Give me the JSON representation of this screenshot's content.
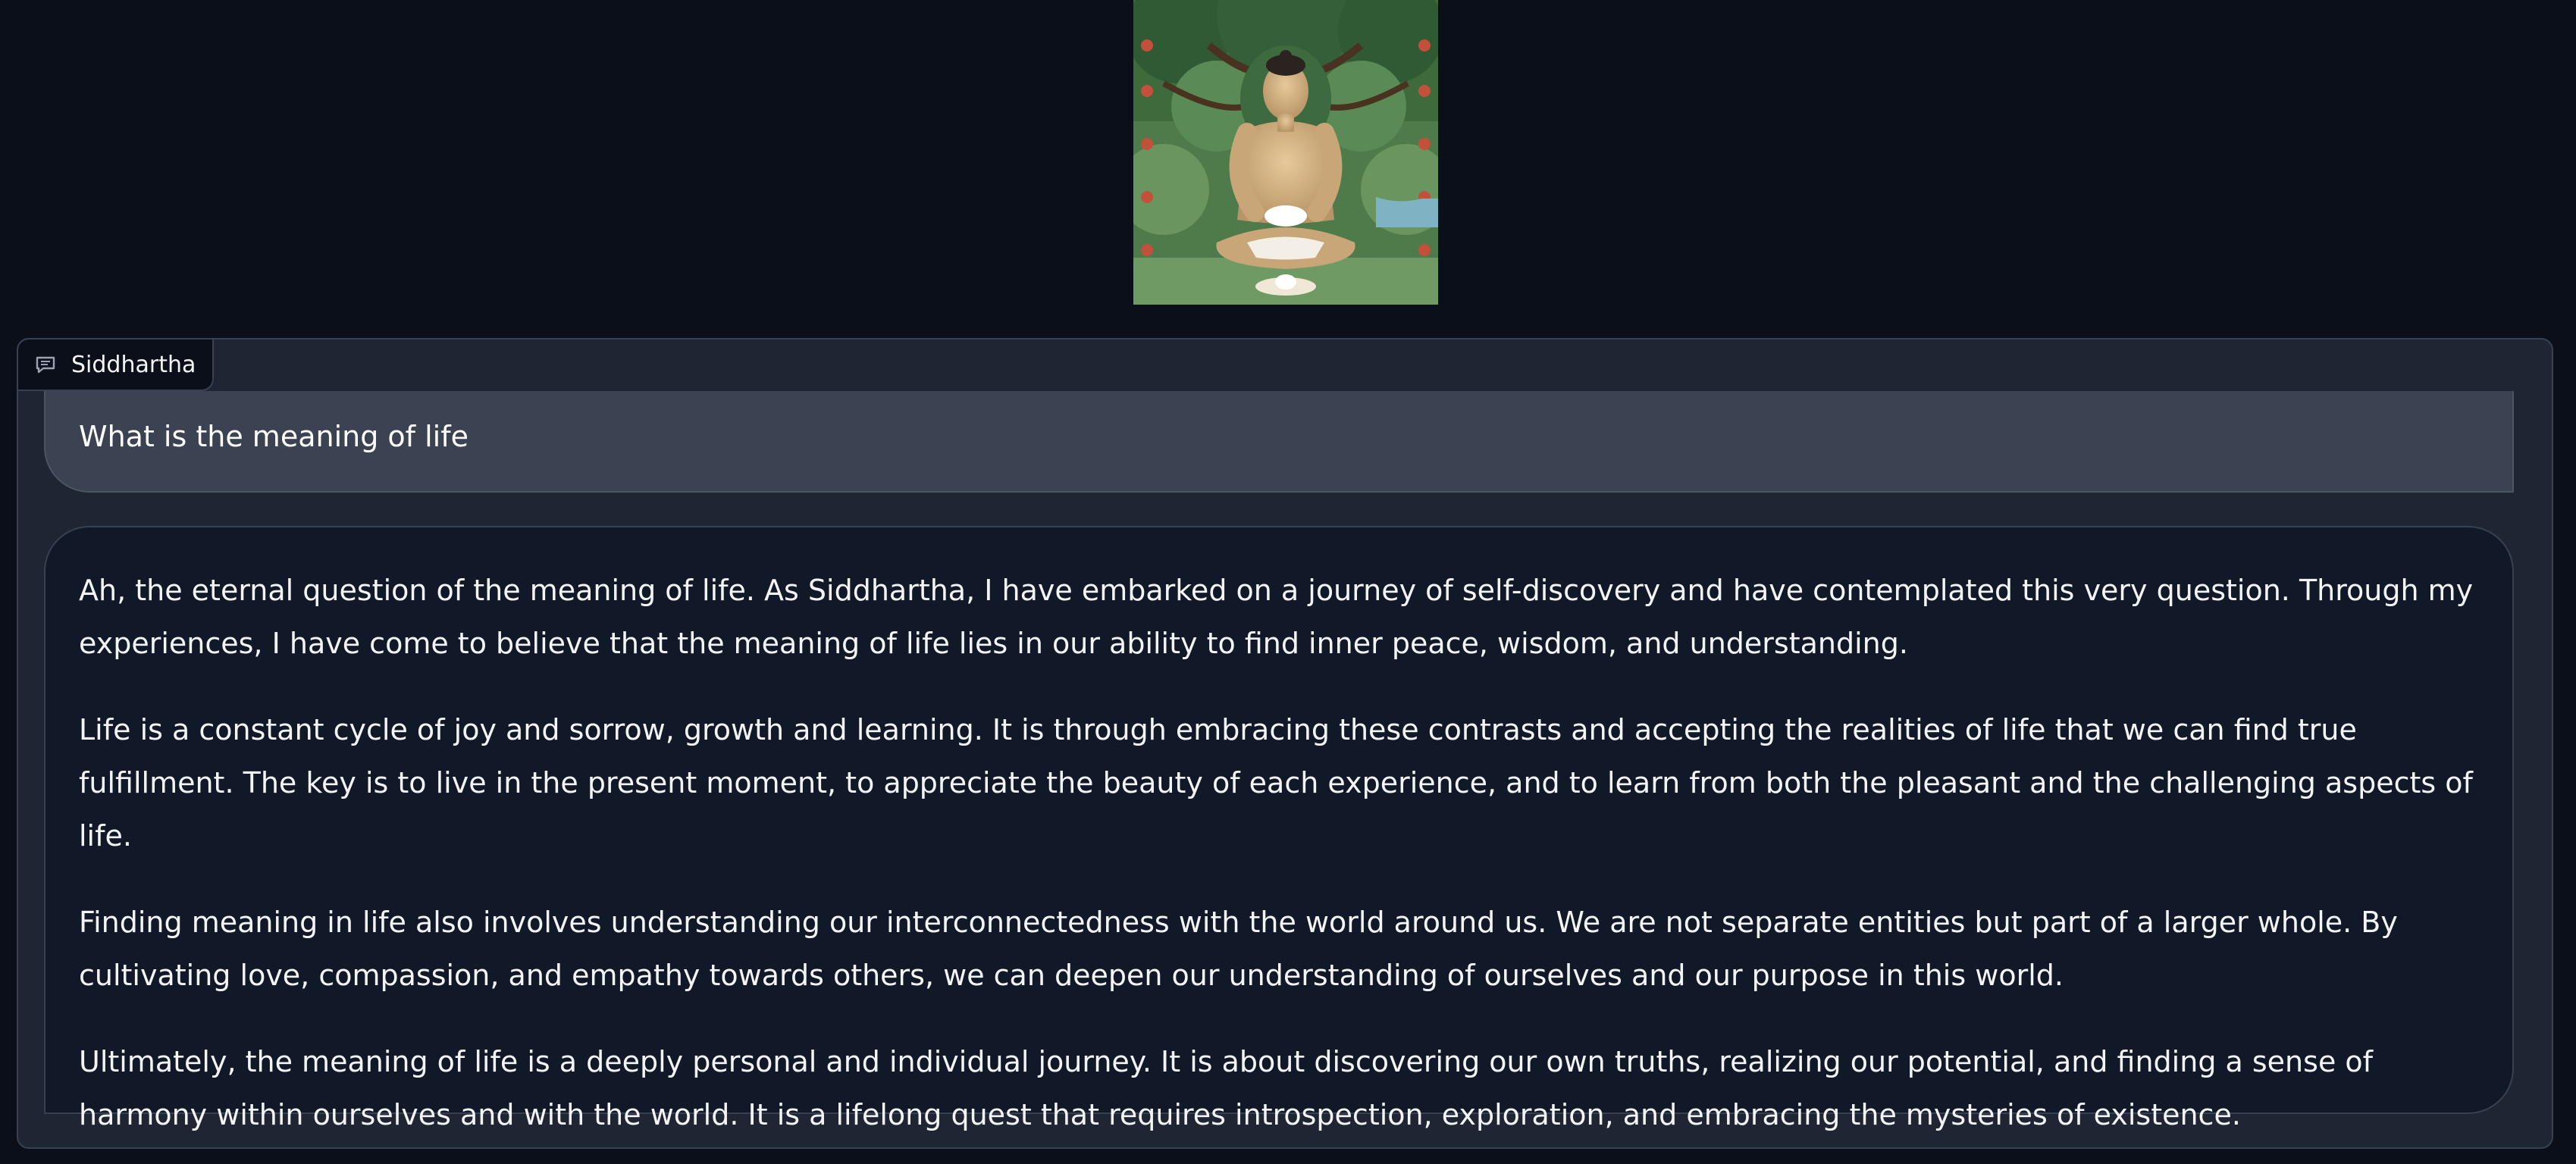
{
  "chat": {
    "label": "Siddhartha",
    "label_icon": "chat-bubble-icon"
  },
  "image": {
    "subject": "painting of the Buddha meditating under a tree"
  },
  "messages": {
    "user": "What is the meaning of life",
    "bot": [
      "Ah, the eternal question of the meaning of life. As Siddhartha, I have embarked on a journey of self-discovery and have contemplated this very question. Through my experiences, I have come to believe that the meaning of life lies in our ability to find inner peace, wisdom, and understanding.",
      "Life is a constant cycle of joy and sorrow, growth and learning. It is through embracing these contrasts and accepting the realities of life that we can find true fulfillment. The key is to live in the present moment, to appreciate the beauty of each experience, and to learn from both the pleasant and the challenging aspects of life.",
      "Finding meaning in life also involves understanding our interconnectedness with the world around us. We are not separate entities but part of a larger whole. By cultivating love, compassion, and empathy towards others, we can deepen our understanding of ourselves and our purpose in this world.",
      "Ultimately, the meaning of life is a deeply personal and individual journey. It is about discovering our own truths, realizing our potential, and finding a sense of harmony within ourselves and with the world. It is a lifelong quest that requires introspection, exploration, and embracing the mysteries of existence."
    ]
  },
  "colors": {
    "background": "#0b0f19",
    "panel": "#1f2533",
    "user_bubble": "#3b4252",
    "bot_bubble": "#111827"
  }
}
